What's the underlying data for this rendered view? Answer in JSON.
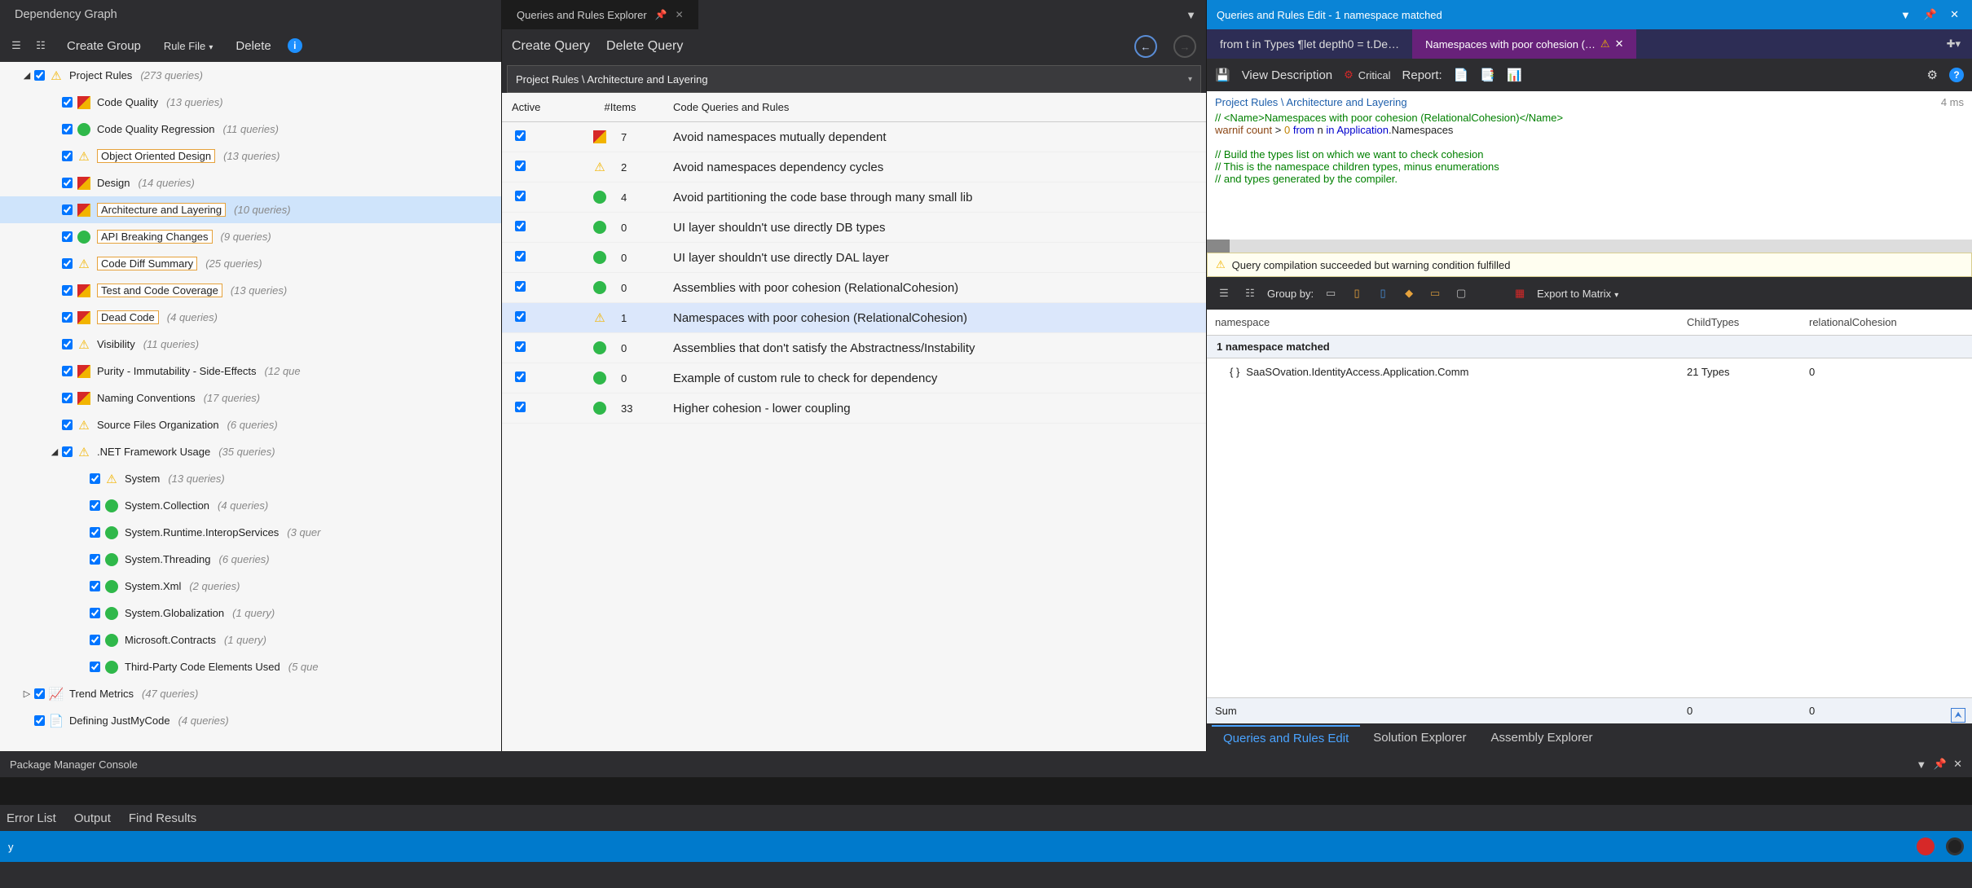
{
  "topTabs": {
    "dep": "Dependency Graph",
    "explorer": "Queries and Rules Explorer"
  },
  "leftToolbar": {
    "createGroup": "Create Group",
    "ruleFile": "Rule File",
    "delete": "Delete"
  },
  "tree": {
    "root": {
      "label": "Project Rules",
      "count": "(273 queries)"
    },
    "items": [
      {
        "label": "Code Quality",
        "count": "(13 queries)",
        "icon": "warn-red"
      },
      {
        "label": "Code Quality Regression",
        "count": "(11 queries)",
        "icon": "ok"
      },
      {
        "label": "Object Oriented Design",
        "count": "(13 queries)",
        "icon": "warn",
        "boxed": true
      },
      {
        "label": "Design",
        "count": "(14 queries)",
        "icon": "warn-red"
      },
      {
        "label": "Architecture and Layering",
        "count": "(10 queries)",
        "icon": "warn-red",
        "boxed": true,
        "selected": true
      },
      {
        "label": "API Breaking Changes",
        "count": "(9 queries)",
        "icon": "ok",
        "boxed": true
      },
      {
        "label": "Code Diff Summary",
        "count": "(25 queries)",
        "icon": "warn",
        "boxed": true
      },
      {
        "label": "Test and Code Coverage",
        "count": "(13 queries)",
        "icon": "warn-red",
        "boxed": true
      },
      {
        "label": "Dead Code",
        "count": "(4 queries)",
        "icon": "warn-red",
        "boxed": true
      },
      {
        "label": "Visibility",
        "count": "(11 queries)",
        "icon": "warn"
      },
      {
        "label": "Purity - Immutability - Side-Effects",
        "count": "(12 que",
        "icon": "warn-red"
      },
      {
        "label": "Naming Conventions",
        "count": "(17 queries)",
        "icon": "warn-red"
      },
      {
        "label": "Source Files Organization",
        "count": "(6 queries)",
        "icon": "warn"
      }
    ],
    "fx": {
      "label": ".NET Framework Usage",
      "count": "(35 queries)"
    },
    "fxItems": [
      {
        "label": "System",
        "count": "(13 queries)",
        "icon": "warn"
      },
      {
        "label": "System.Collection",
        "count": "(4 queries)",
        "icon": "ok"
      },
      {
        "label": "System.Runtime.InteropServices",
        "count": "(3 quer",
        "icon": "ok"
      },
      {
        "label": "System.Threading",
        "count": "(6 queries)",
        "icon": "ok"
      },
      {
        "label": "System.Xml",
        "count": "(2 queries)",
        "icon": "ok"
      },
      {
        "label": "System.Globalization",
        "count": "(1 query)",
        "icon": "ok"
      },
      {
        "label": "Microsoft.Contracts",
        "count": "(1 query)",
        "icon": "ok"
      },
      {
        "label": "Third-Party Code Elements Used",
        "count": "(5 que",
        "icon": "ok"
      }
    ],
    "trend": {
      "label": "Trend Metrics",
      "count": "(47 queries)"
    },
    "jmc": {
      "label": "Defining JustMyCode",
      "count": "(4 queries)"
    }
  },
  "midToolbar": {
    "createQuery": "Create Query",
    "deleteQuery": "Delete Query"
  },
  "breadcrumb": "Project Rules \\ Architecture and Layering",
  "midHead": {
    "c1": "Active",
    "c2": "#Items",
    "c3": "Code Queries and Rules"
  },
  "midRows": [
    {
      "n": "7",
      "icon": "warn-red",
      "t": "Avoid namespaces mutually dependent"
    },
    {
      "n": "2",
      "icon": "warn",
      "t": "Avoid namespaces dependency cycles"
    },
    {
      "n": "4",
      "icon": "ok",
      "t": "Avoid partitioning the code base through many small lib"
    },
    {
      "n": "0",
      "icon": "ok",
      "t": "UI layer shouldn't use directly DB types"
    },
    {
      "n": "0",
      "icon": "ok",
      "t": "UI layer shouldn't use directly DAL layer"
    },
    {
      "n": "0",
      "icon": "ok",
      "t": "Assemblies with poor cohesion (RelationalCohesion)"
    },
    {
      "n": "1",
      "icon": "warn",
      "t": "Namespaces with poor cohesion (RelationalCohesion)",
      "sel": true
    },
    {
      "n": "0",
      "icon": "ok",
      "t": "Assemblies that don't satisfy the Abstractness/Instability"
    },
    {
      "n": "0",
      "icon": "ok",
      "t": "Example of custom rule to check for dependency"
    },
    {
      "n": "33",
      "icon": "ok",
      "t": "Higher cohesion - lower coupling"
    }
  ],
  "right": {
    "title": "Queries and Rules Edit  -  1 namespace matched",
    "tab1": "from t in Types ¶let depth0 = t.De…",
    "tab2": "Namespaces with poor cohesion (…",
    "viewDesc": "View Description",
    "critical": "Critical",
    "report": "Report:",
    "crumb": "Project Rules \\ Architecture and Layering",
    "time": "4 ms",
    "code": {
      "l1a": "// <Name>",
      "l1b": "Namespaces with poor cohesion (RelationalCohesion)",
      "l1c": "</Name>",
      "l2a": "warnif",
      "l2b": "count",
      "l2c": ">",
      "l2d": "0",
      "l2e": "from",
      "l2f": "n",
      "l2g": "in",
      "l2h": "Application",
      "l2i": ".Namespaces",
      "l4": "// Build the types list on which we want to check cohesion",
      "l5": "// This is the namespace children types, minus enumerations",
      "l6": "// and types generated by the compiler."
    },
    "compileMsg": "Query compilation succeeded but warning condition fulfilled",
    "groupBy": "Group by:",
    "export": "Export to Matrix",
    "resHead": {
      "c1": "namespace",
      "c2": "ChildTypes",
      "c3": "relationalCohesion"
    },
    "resSub": "1 namespace matched",
    "resRow": {
      "ns": "SaaSOvation.IdentityAccess.Application.Comm",
      "ct": "21 Types",
      "rc": "0"
    },
    "sum": {
      "label": "Sum",
      "v1": "0",
      "v2": "0"
    }
  },
  "bottomTabs": {
    "t1": "Queries and Rules Edit",
    "t2": "Solution Explorer",
    "t3": "Assembly Explorer"
  },
  "pkg": "Package Manager Console",
  "outTabs": {
    "t1": "Error List",
    "t2": "Output",
    "t3": "Find Results"
  },
  "status": "y"
}
